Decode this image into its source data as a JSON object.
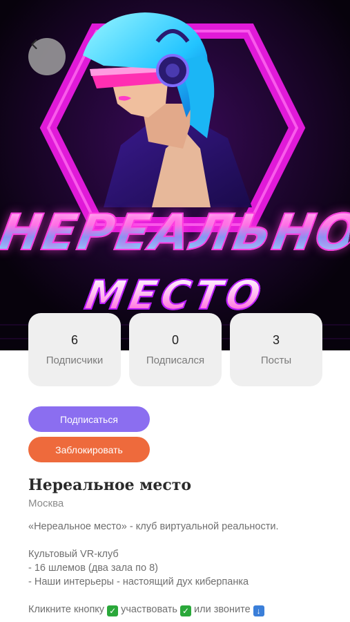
{
  "cover": {
    "logo_line1": "НЕРЕАЛЬНОЕ",
    "logo_line2": "МЕСТО"
  },
  "colors": {
    "accent_purple": "#8b6ef0",
    "accent_orange": "#ee6a3c",
    "card_bg": "#efefef"
  },
  "stats": [
    {
      "value": "6",
      "label": "Подписчики"
    },
    {
      "value": "0",
      "label": "Подписался"
    },
    {
      "value": "3",
      "label": "Посты"
    }
  ],
  "actions": {
    "subscribe_label": "Подписаться",
    "block_label": "Заблокировать"
  },
  "profile": {
    "name": "Нереальное место",
    "city": "Москва",
    "description": {
      "line1": "«Нереальное место» - клуб виртуальной реальности.",
      "line2": "Культовый VR-клуб",
      "line3": "- 16 шлемов (два зала по 8)",
      "line4": "- Наши интерьеры - настоящий дух киберпанка",
      "cta_part1": "Кликните кнопку",
      "cta_part2": "участвовать",
      "cta_part3": "или звоните"
    }
  }
}
